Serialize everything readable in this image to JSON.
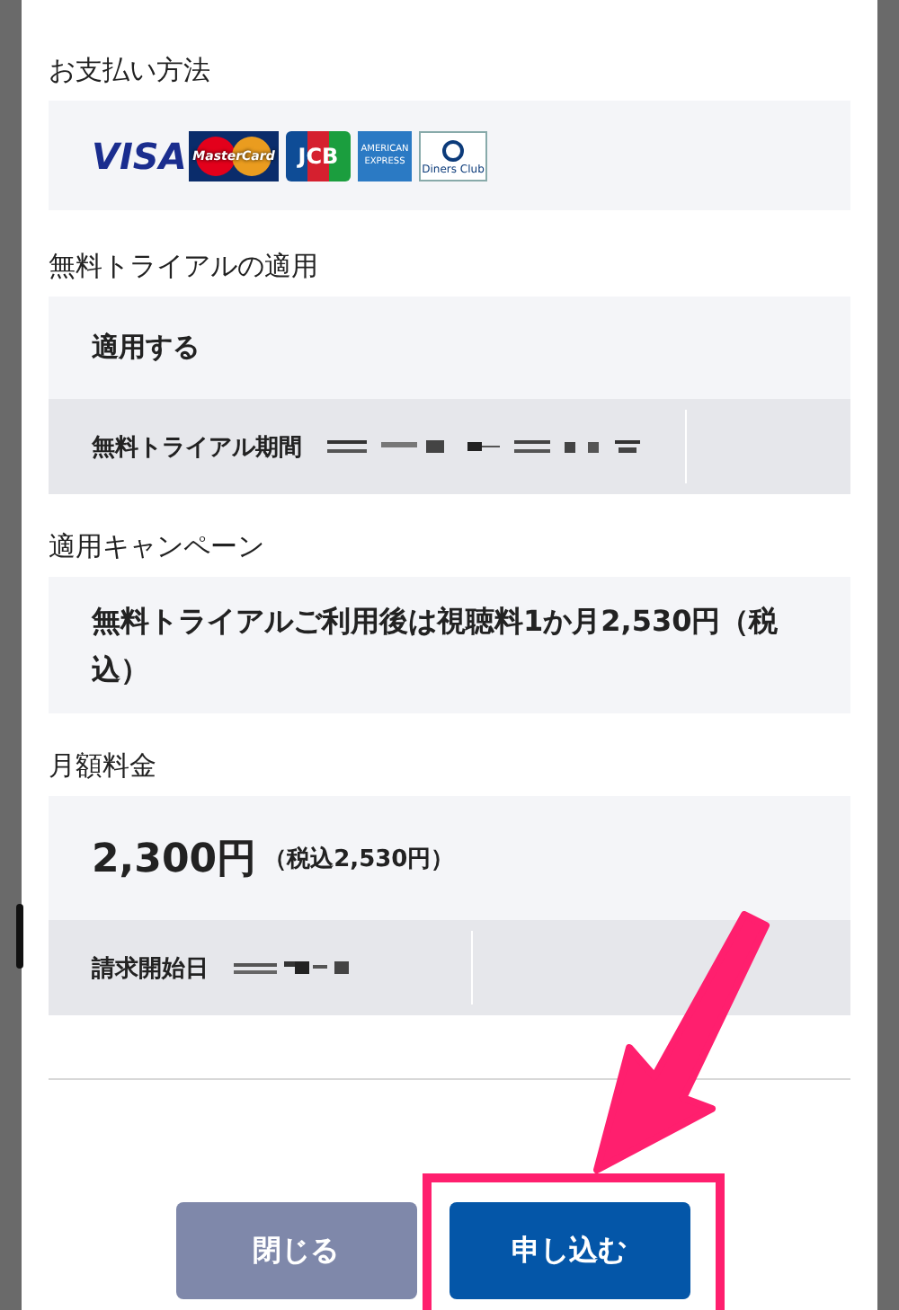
{
  "payment": {
    "label": "お支払い方法",
    "cards": [
      {
        "kind": "visa",
        "text": "VISA"
      },
      {
        "kind": "mastercard",
        "text": "MasterCard"
      },
      {
        "kind": "jcb",
        "text": "JCB"
      },
      {
        "kind": "amex",
        "text": "AMERICAN EXPRESS"
      },
      {
        "kind": "diners",
        "text": "Diners Club"
      }
    ]
  },
  "trial": {
    "label": "無料トライアルの適用",
    "value": "適用する",
    "period_label": "無料トライアル期間"
  },
  "campaign": {
    "label": "適用キャンペーン",
    "text": "無料トライアルご利用後は視聴料1か月2,530円（税込）"
  },
  "monthly": {
    "label": "月額料金",
    "price": "2,300円",
    "tax_note": "（税込2,530円）",
    "start_label": "請求開始日"
  },
  "buttons": [
    {
      "kind": "secondary",
      "label": "閉じる"
    },
    {
      "kind": "primary",
      "label": "申し込む",
      "highlighted": true
    }
  ]
}
